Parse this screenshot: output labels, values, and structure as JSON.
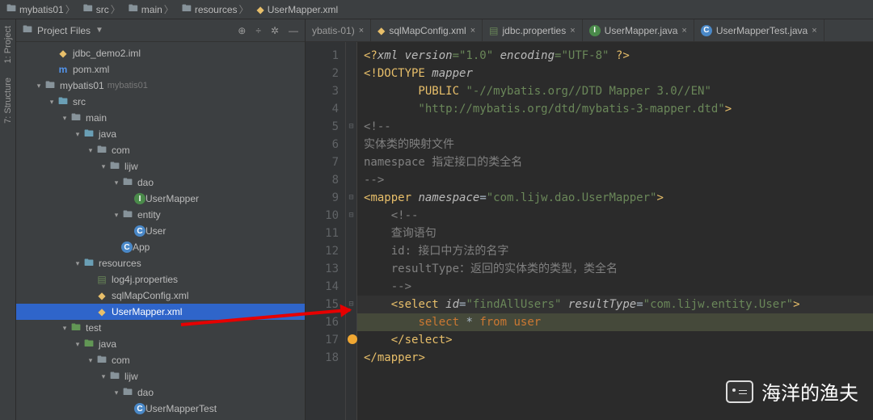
{
  "breadcrumb": [
    {
      "icon": "folder",
      "label": "mybatis01"
    },
    {
      "icon": "folder",
      "label": "src"
    },
    {
      "icon": "folder",
      "label": "main"
    },
    {
      "icon": "folder",
      "label": "resources"
    },
    {
      "icon": "xml",
      "label": "UserMapper.xml"
    }
  ],
  "gutter": {
    "project": "1: Project",
    "structure": "7: Structure"
  },
  "sidebar": {
    "title": "Project Files",
    "actions": [
      "target",
      "divide",
      "gear",
      "collapse"
    ]
  },
  "tree": [
    {
      "depth": 2,
      "arrow": "",
      "icon": "xml",
      "label": "jdbc_demo2.iml"
    },
    {
      "depth": 2,
      "arrow": "",
      "icon": "m",
      "label": "pom.xml"
    },
    {
      "depth": 1,
      "arrow": "v",
      "icon": "folder",
      "label": "mybatis01",
      "sub": "mybatis01"
    },
    {
      "depth": 2,
      "arrow": "v",
      "icon": "folder-blue",
      "label": "src"
    },
    {
      "depth": 3,
      "arrow": "v",
      "icon": "folder",
      "label": "main"
    },
    {
      "depth": 4,
      "arrow": "v",
      "icon": "folder-blue",
      "label": "java"
    },
    {
      "depth": 5,
      "arrow": "v",
      "icon": "folder",
      "label": "com"
    },
    {
      "depth": 6,
      "arrow": "v",
      "icon": "folder",
      "label": "lijw"
    },
    {
      "depth": 7,
      "arrow": "v",
      "icon": "folder",
      "label": "dao"
    },
    {
      "depth": 8,
      "arrow": "",
      "icon": "interface",
      "label": "UserMapper"
    },
    {
      "depth": 7,
      "arrow": "v",
      "icon": "folder",
      "label": "entity"
    },
    {
      "depth": 8,
      "arrow": "",
      "icon": "class",
      "label": "User"
    },
    {
      "depth": 7,
      "arrow": "",
      "icon": "class",
      "label": "App"
    },
    {
      "depth": 4,
      "arrow": "v",
      "icon": "folder-blue",
      "label": "resources"
    },
    {
      "depth": 5,
      "arrow": "",
      "icon": "prop",
      "label": "log4j.properties"
    },
    {
      "depth": 5,
      "arrow": "",
      "icon": "xml",
      "label": "sqlMapConfig.xml"
    },
    {
      "depth": 5,
      "arrow": "",
      "icon": "xml",
      "label": "UserMapper.xml",
      "selected": true
    },
    {
      "depth": 3,
      "arrow": "v",
      "icon": "folder-green",
      "label": "test"
    },
    {
      "depth": 4,
      "arrow": "v",
      "icon": "folder-green",
      "label": "java"
    },
    {
      "depth": 5,
      "arrow": "v",
      "icon": "folder",
      "label": "com"
    },
    {
      "depth": 6,
      "arrow": "v",
      "icon": "folder",
      "label": "lijw"
    },
    {
      "depth": 7,
      "arrow": "v",
      "icon": "folder",
      "label": "dao"
    },
    {
      "depth": 8,
      "arrow": "",
      "icon": "class",
      "label": "UserMapperTest"
    }
  ],
  "tabs": [
    {
      "icon": "trunc",
      "label": "ybatis-01)",
      "trunc": true
    },
    {
      "icon": "xml",
      "label": "sqlMapConfig.xml"
    },
    {
      "icon": "prop",
      "label": "jdbc.properties"
    },
    {
      "icon": "interface",
      "label": "UserMapper.java"
    },
    {
      "icon": "class",
      "label": "UserMapperTest.java"
    }
  ],
  "code": {
    "l1_a": "<?",
    "l1_b": "xml version",
    "l1_c": "=\"1.0\" ",
    "l1_d": "encoding",
    "l1_e": "=\"UTF-8\" ",
    "l1_f": "?>",
    "l2": "<!DOCTYPE ",
    "l2b": "mapper",
    "l3a": "        PUBLIC ",
    "l3b": "\"-//mybatis.org//DTD Mapper 3.0//EN\"",
    "l4": "        \"http://mybatis.org/dtd/mybatis-3-mapper.dtd\"",
    "l4b": ">",
    "l5": "<!--",
    "l6": "实体类的映射文件",
    "l7": "namespace 指定接口的类全名",
    "l8": "-->",
    "l9a": "<",
    "l9b": "mapper ",
    "l9c": "namespace",
    "l9d": "=",
    "l9e": "\"com.lijw.dao.UserMapper\"",
    "l9f": ">",
    "l10": "    <!--",
    "l11": "    查询语句",
    "l12": "    id: 接口中方法的名字",
    "l13": "    resultType：返回的实体类的类型，类全名",
    "l14": "    -->",
    "l15a": "    <",
    "l15b": "select ",
    "l15c": "id",
    "l15d": "=",
    "l15e": "\"findAllUsers\" ",
    "l15f": "resultType",
    "l15g": "=",
    "l15h": "\"com.lijw.entity.User\"",
    "l15i": ">",
    "l16a": "        ",
    "l16b": "select ",
    "l16c": "* ",
    "l16d": "from ",
    "l16e": "user",
    "l17a": "    </",
    "l17b": "select",
    "l17c": ">",
    "l18a": "</",
    "l18b": "mapper",
    "l18c": ">"
  },
  "linecount": 18,
  "watermark": "海洋的渔夫"
}
